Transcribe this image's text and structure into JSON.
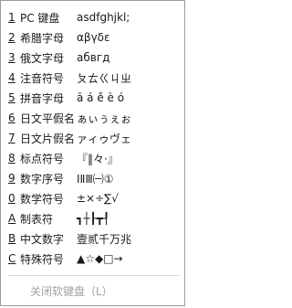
{
  "menu": {
    "items": [
      {
        "key": "1",
        "label": "PC 键盘",
        "sample": "asdfghjkl;"
      },
      {
        "key": "2",
        "label": "希腊字母",
        "sample": "αβγδε"
      },
      {
        "key": "3",
        "label": "俄文字母",
        "sample": "абвгд"
      },
      {
        "key": "4",
        "label": "注音符号",
        "sample": "ㄆㄊㄍㄐㄓ"
      },
      {
        "key": "5",
        "label": "拼音字母",
        "sample": "ā á ě è ó"
      },
      {
        "key": "6",
        "label": "日文平假名",
        "sample": "ぁぃぅぇぉ"
      },
      {
        "key": "7",
        "label": "日文片假名",
        "sample": "ァィゥヴェ"
      },
      {
        "key": "8",
        "label": "标点符号",
        "sample": "『‖々·』"
      },
      {
        "key": "9",
        "label": "数字序号",
        "sample": "ⅠⅡⅢ㈠①"
      },
      {
        "key": "0",
        "label": "数学符号",
        "sample": "±×÷∑√"
      },
      {
        "key": "A",
        "label": "制表符",
        "sample": "┓┼┠┳┦"
      },
      {
        "key": "B",
        "label": "中文数字",
        "sample": "壹贰千万兆"
      },
      {
        "key": "C",
        "label": "特殊符号",
        "sample": "▲☆◆□→"
      }
    ],
    "close_label": "关闭软键盘（L）"
  }
}
